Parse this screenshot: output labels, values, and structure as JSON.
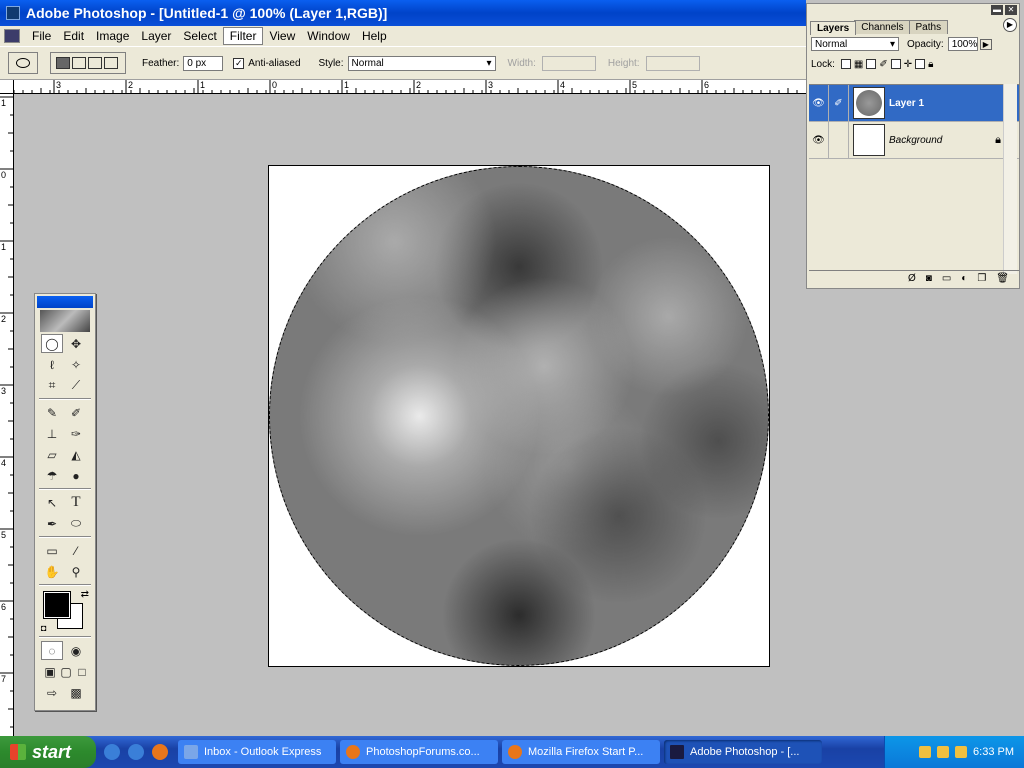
{
  "window": {
    "title": "Adobe Photoshop - [Untitled-1 @ 100% (Layer 1,RGB)]"
  },
  "menu": [
    "File",
    "Edit",
    "Image",
    "Layer",
    "Select",
    "Filter",
    "View",
    "Window",
    "Help"
  ],
  "options": {
    "feather_label": "Feather:",
    "feather_value": "0 px",
    "antialiased_label": "Anti-aliased",
    "antialiased_checked": "✓",
    "style_label": "Style:",
    "style_value": "Normal",
    "width_label": "Width:",
    "height_label": "Height:"
  },
  "ruler_h": [
    "3",
    "2",
    "1",
    "0",
    "1",
    "2",
    "3",
    "4",
    "5",
    "6"
  ],
  "ruler_v": [
    "1",
    "0",
    "1",
    "2",
    "3",
    "4",
    "5",
    "6",
    "7"
  ],
  "layers_panel": {
    "tabs": [
      "Layers",
      "Channels",
      "Paths"
    ],
    "blend_mode": "Normal",
    "opacity_label": "Opacity:",
    "opacity_value": "100%",
    "lock_label": "Lock:",
    "layers": [
      {
        "name": "Layer 1"
      },
      {
        "name": "Background"
      }
    ]
  },
  "taskbar": {
    "start": "start",
    "tasks": [
      {
        "label": "Inbox - Outlook Express"
      },
      {
        "label": "PhotoshopForums.co..."
      },
      {
        "label": "Mozilla Firefox Start P..."
      },
      {
        "label": "Adobe Photoshop - [..."
      }
    ],
    "clock": "6:33 PM"
  }
}
